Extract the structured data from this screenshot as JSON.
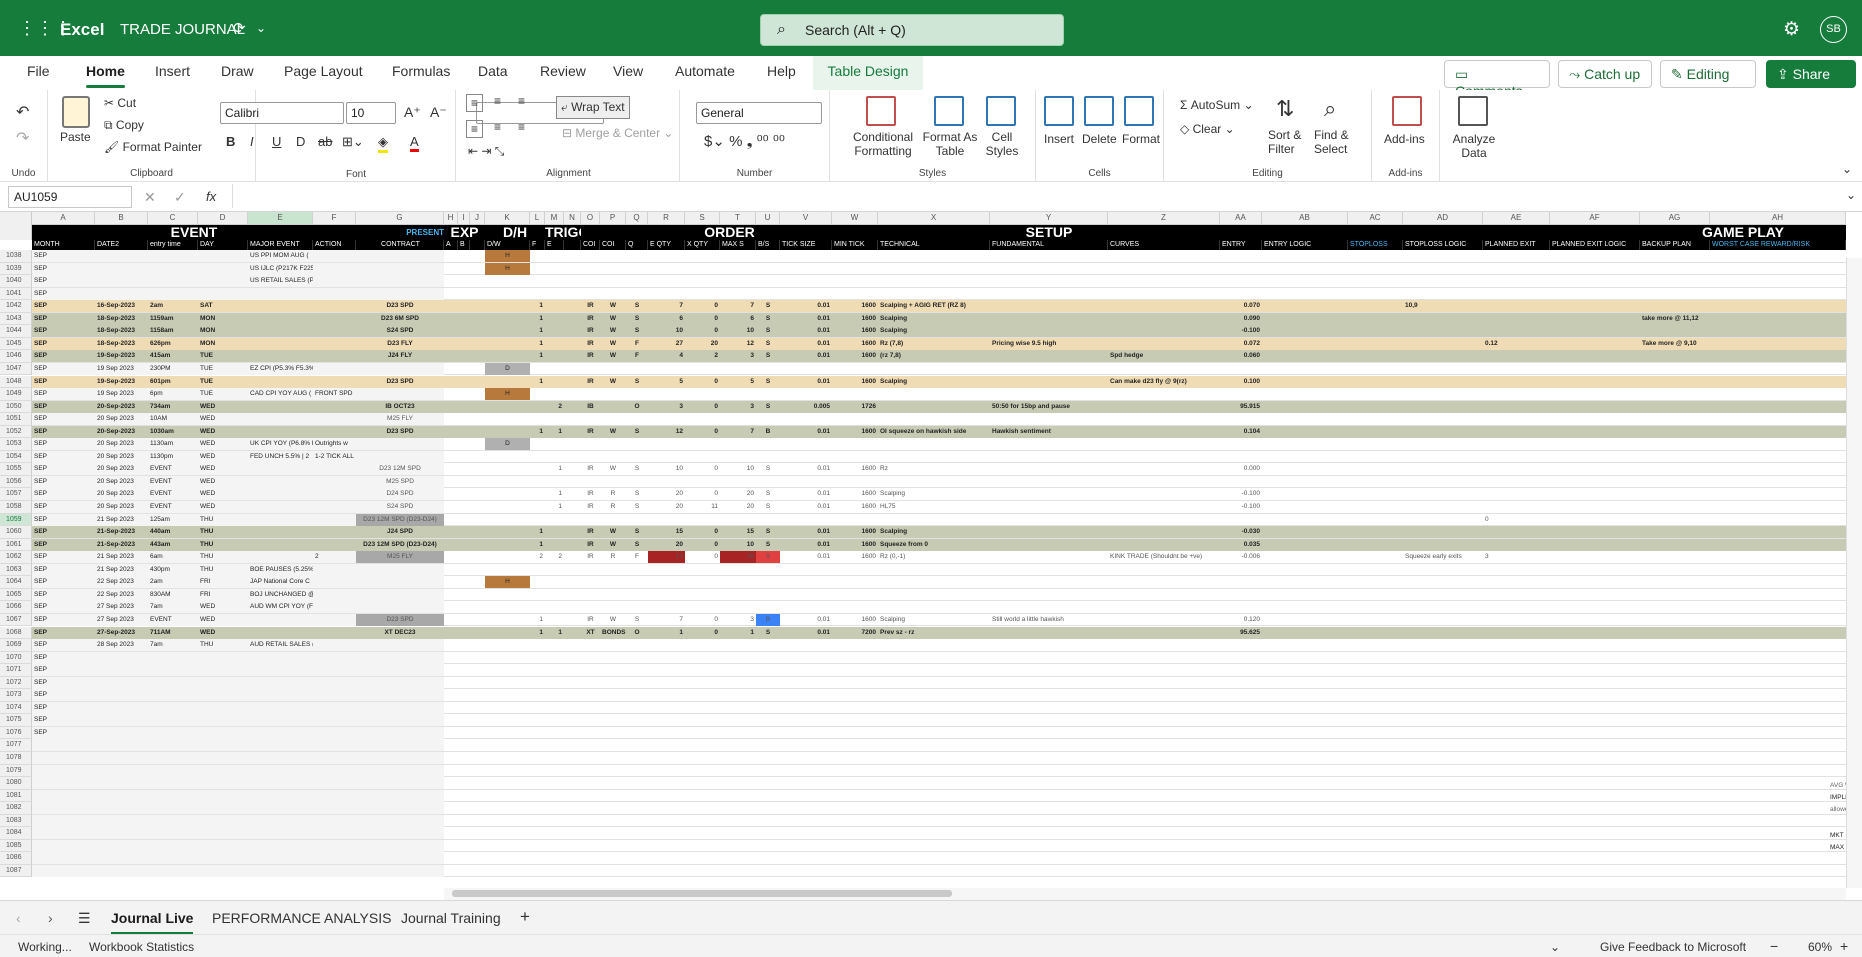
{
  "titlebar": {
    "app": "Excel",
    "doc": "TRADE JOURNAL",
    "search": "Search (Alt + Q)",
    "avatar": "SB"
  },
  "menu": [
    "File",
    "Home",
    "Insert",
    "Draw",
    "Page Layout",
    "Formulas",
    "Data",
    "Review",
    "View",
    "Automate",
    "Help",
    "Table Design"
  ],
  "actions": {
    "comments": "Comments",
    "catchup": "Catch up",
    "editing": "Editing",
    "share": "Share"
  },
  "ribbon": {
    "undo": "Undo",
    "paste": "Paste",
    "cut": "Cut",
    "copy": "Copy",
    "format_painter": "Format Painter",
    "clipboard": "Clipboard",
    "font_name": "Calibri",
    "font_size": "10",
    "font": "Font",
    "wrap_text": "Wrap Text",
    "merge": "Merge & Center",
    "alignment": "Alignment",
    "number_format": "General",
    "number": "Number",
    "cond_format": "Conditional Formatting",
    "format_table": "Format As Table",
    "cell_styles": "Cell Styles",
    "styles": "Styles",
    "insert": "Insert",
    "delete": "Delete",
    "format": "Format",
    "cells": "Cells",
    "autosum": "AutoSum",
    "clear": "Clear",
    "sort_filter": "Sort & Filter",
    "find_select": "Find & Select",
    "editing": "Editing",
    "addins": "Add-ins",
    "addins_grp": "Add-ins",
    "analyze": "Analyze Data"
  },
  "formula": {
    "namebox": "AU1059",
    "fx": "fx"
  },
  "bands": [
    "EVENT",
    "PRESENT",
    "EXP",
    "D/H",
    "TRIGGER",
    "ORDER",
    "SETUP",
    "GAME PLAY"
  ],
  "headers": [
    "MONTH",
    "DATE2",
    "entry time",
    "DAY",
    "MAJOR EVENT",
    "ACTION",
    "CONTRACT",
    "A",
    "B",
    "D/W",
    "F",
    "E",
    "COI",
    "COI",
    "Q",
    "E QTY",
    "X QTY",
    "MAX S",
    "B/S",
    "TICK SIZE",
    "MIN TICK",
    "TECHNICAL",
    "FUNDAMENTAL",
    "CURVES",
    "ENTRY",
    "ENTRY LOGIC",
    "STOPLOSS",
    "STOPLOSS LOGIC",
    "PLANNED EXIT",
    "PLANNED EXIT LOGIC",
    "BACKUP PLAN",
    "WORST CASE REWARD/RISK",
    "WORS"
  ],
  "colletters": [
    "A",
    "B",
    "C",
    "D",
    "E",
    "F",
    "G",
    "H",
    "I",
    "J",
    "K",
    "L",
    "M",
    "N",
    "O",
    "P",
    "Q",
    "R",
    "S",
    "T",
    "U",
    "V",
    "W",
    "X",
    "Y",
    "Z",
    "AA",
    "AB",
    "AC",
    "AD",
    "AE",
    "AF",
    "AG",
    "AH"
  ],
  "rows": [
    {
      "n": "1038",
      "m": "SEP",
      "ev": "US PPI MOM AUG (",
      "dh": "H"
    },
    {
      "n": "1039",
      "m": "SEP",
      "ev": "US IJLC (P217K F225",
      "dh": "H"
    },
    {
      "n": "1040",
      "m": "SEP",
      "ev": "US RETAIL SALES (P("
    },
    {
      "n": "1041",
      "m": "SEP"
    },
    {
      "n": "1042",
      "m": "SEP",
      "d": "16-Sep-2023",
      "t": "2am",
      "day": "SAT",
      "c": "D23 SPD",
      "l": "1",
      "o": "IR",
      "p": "W",
      "q": "S",
      "r": "7",
      "s": "0",
      "tt": "7",
      "u": "S",
      "v": "0.01",
      "w": "1600",
      "x": "Scalping + AGIG RET (RZ 8)",
      "aa": "0.070",
      "ad": "10,9",
      "bg": "#f0dcb4"
    },
    {
      "n": "1043",
      "m": "SEP",
      "d": "18-Sep-2023",
      "t": "1159am",
      "day": "MON",
      "c": "D23 6M SPD",
      "l": "1",
      "o": "IR",
      "p": "W",
      "q": "S",
      "r": "6",
      "s": "0",
      "tt": "6",
      "u": "S",
      "v": "0.01",
      "w": "1600",
      "x": "Scalping",
      "aa": "0.090",
      "ag": "take more @ 11,12",
      "bg": "#c8cbb4"
    },
    {
      "n": "1044",
      "m": "SEP",
      "d": "18-Sep-2023",
      "t": "1158am",
      "day": "MON",
      "c": "S24 SPD",
      "l": "1",
      "o": "IR",
      "p": "W",
      "q": "S",
      "r": "10",
      "s": "0",
      "tt": "10",
      "u": "S",
      "v": "0.01",
      "w": "1600",
      "x": "Scalping",
      "aa": "-0.100",
      "bg": "#c8cbb4"
    },
    {
      "n": "1045",
      "m": "SEP",
      "d": "18-Sep-2023",
      "t": "626pm",
      "day": "MON",
      "c": "D23 FLY",
      "l": "1",
      "o": "IR",
      "p": "W",
      "q": "F",
      "r": "27",
      "s": "20",
      "tt": "12",
      "u": "S",
      "v": "0.01",
      "w": "1600",
      "x": "Rz (7,8)",
      "y": "Pricing wise 9.5 high",
      "aa": "0.072",
      "ae": "0.12",
      "ag": "Take more @ 9,10",
      "bg": "#f0dcb4"
    },
    {
      "n": "1046",
      "m": "SEP",
      "d": "19-Sep-2023",
      "t": "415am",
      "day": "TUE",
      "c": "J24 FLY",
      "l": "1",
      "o": "IR",
      "p": "W",
      "q": "F",
      "r": "4",
      "s": "2",
      "tt": "3",
      "u": "S",
      "v": "0.01",
      "w": "1600",
      "x": "(rz 7,8)",
      "z": "Spd hedge",
      "aa": "0.060",
      "bg": "#c8cbb4"
    },
    {
      "n": "1047",
      "m": "SEP",
      "d": "19 Sep 2023",
      "t": "230PM",
      "day": "TUE",
      "ev": "EZ CPI (P5.3% F5.3%",
      "dh": "D"
    },
    {
      "n": "1048",
      "m": "SEP",
      "d": "19-Sep-2023",
      "t": "601pm",
      "day": "TUE",
      "c": "D23 SPD",
      "l": "1",
      "o": "IR",
      "p": "W",
      "q": "S",
      "r": "5",
      "s": "0",
      "tt": "5",
      "u": "S",
      "v": "0.01",
      "w": "1600",
      "x": "Scalping",
      "z": "Can make d23 fly @ 9(rz)",
      "aa": "0.100",
      "bg": "#f0dcb4"
    },
    {
      "n": "1049",
      "m": "SEP",
      "d": "19 Sep 2023",
      "t": "6pm",
      "day": "TUE",
      "ev": "CAD CPI YOY AUG (",
      "ac": "FRONT SPD",
      "dh": "H"
    },
    {
      "n": "1050",
      "m": "SEP",
      "d": "20-Sep-2023",
      "t": "734am",
      "day": "WED",
      "c": "IB OCT23",
      "l2": "2",
      "o": "IB",
      "q": "O",
      "r": "3",
      "s": "0",
      "tt": "3",
      "u": "S",
      "v": "0.005",
      "w": "1726",
      "y": "50:50 for 15bp and pause",
      "aa": "95.915",
      "bg": "#c8cbb4"
    },
    {
      "n": "1051",
      "m": "SEP",
      "d": "20 Sep 2023",
      "t": "10AM",
      "day": "WED",
      "c": "M25 FLY"
    },
    {
      "n": "1052",
      "m": "SEP",
      "d": "20-Sep-2023",
      "t": "1030am",
      "day": "WED",
      "c": "D23 SPD",
      "l": "1",
      "l2": "1",
      "o": "IR",
      "p": "W",
      "q": "S",
      "r": "12",
      "s": "0",
      "tt": "7",
      "u": "B",
      "v": "0.01",
      "w": "1600",
      "x": "OI squeeze on hawkish side",
      "y": "Hawkish sentiment",
      "aa": "0.104",
      "bg": "#c8cbb4"
    },
    {
      "n": "1053",
      "m": "SEP",
      "d": "20 Sep 2023",
      "t": "1130am",
      "day": "WED",
      "ev": "UK CPI YOY (P6.8% F",
      "ac": "Outrights w",
      "dh": "D"
    },
    {
      "n": "1054",
      "m": "SEP",
      "d": "20 Sep 2023",
      "t": "1130pm",
      "day": "WED",
      "ev": "FED UNCH 5.5% | 2",
      "ac": "1-2 TICK ALL"
    },
    {
      "n": "1055",
      "m": "SEP",
      "d": "20 Sep 2023",
      "t": "EVENT",
      "day": "WED",
      "c": "D23 12M SPD",
      "l2": "1",
      "o": "IR",
      "p": "W",
      "q": "S",
      "r": "10",
      "s": "0",
      "tt": "10",
      "u": "S",
      "v": "0.01",
      "w": "1600",
      "x": "Rz",
      "aa": "0.000"
    },
    {
      "n": "1056",
      "m": "SEP",
      "d": "20 Sep 2023",
      "t": "EVENT",
      "day": "WED",
      "c": "M25 SPD"
    },
    {
      "n": "1057",
      "m": "SEP",
      "d": "20 Sep 2023",
      "t": "EVENT",
      "day": "WED",
      "c": "D24 SPD",
      "l2": "1",
      "o": "IR",
      "p": "R",
      "q": "S",
      "r": "20",
      "s": "0",
      "tt": "20",
      "u": "S",
      "v": "0.01",
      "w": "1600",
      "x": "Scalping",
      "aa": "-0.100"
    },
    {
      "n": "1058",
      "m": "SEP",
      "d": "20 Sep 2023",
      "t": "EVENT",
      "day": "WED",
      "c": "S24 SPD",
      "l2": "1",
      "o": "IR",
      "p": "R",
      "q": "S",
      "r": "20",
      "s": "11",
      "tt": "20",
      "u": "S",
      "v": "0.01",
      "w": "1600",
      "x": "HL75",
      "aa": "-0.100"
    },
    {
      "n": "1059",
      "m": "SEP",
      "d": "21 Sep 2023",
      "t": "125am",
      "day": "THU",
      "c": "D23 12M SPD (D23-D24)",
      "ae": "0"
    },
    {
      "n": "1060",
      "m": "SEP",
      "d": "21-Sep-2023",
      "t": "440am",
      "day": "THU",
      "c": "J24 SPD",
      "l": "1",
      "o": "IR",
      "p": "W",
      "q": "S",
      "r": "15",
      "s": "0",
      "tt": "15",
      "u": "S",
      "v": "0.01",
      "w": "1600",
      "x": "Scalping",
      "aa": "-0.030",
      "bg": "#c8cbb4"
    },
    {
      "n": "1061",
      "m": "SEP",
      "d": "21-Sep-2023",
      "t": "443am",
      "day": "THU",
      "c": "D23 12M SPD (D23-D24)",
      "l": "1",
      "o": "IR",
      "p": "W",
      "q": "S",
      "r": "20",
      "s": "0",
      "tt": "10",
      "u": "S",
      "v": "0.01",
      "w": "1600",
      "x": "Squeeze from 0",
      "aa": "0.035",
      "bg": "#c8cbb4"
    },
    {
      "n": "1062",
      "m": "SEP",
      "d": "21 Sep 2023",
      "t": "6am",
      "day": "THU",
      "c": "M25 FLY",
      "l": "2",
      "l2": "2",
      "o": "IR",
      "p": "R",
      "q": "F",
      "r": "13",
      "s": "0",
      "tt": "26",
      "u": "S",
      "v": "0.01",
      "w": "1600",
      "x": "Rz (0,-1)",
      "z": "KINK TRADE (Shouldnt be +ve)",
      "aa": "-0.006",
      "ac": "2",
      "ad": "Squeeze early exits",
      "ae": "3",
      "red": "1"
    },
    {
      "n": "1063",
      "m": "SEP",
      "d": "21 Sep 2023",
      "t": "430pm",
      "day": "THU",
      "ev": "BOE PAUSES (5.25%"
    },
    {
      "n": "1064",
      "m": "SEP",
      "d": "22 Sep 2023",
      "t": "2am",
      "day": "FRI",
      "ev": "JAP National Core C",
      "dh": "H"
    },
    {
      "n": "1065",
      "m": "SEP",
      "d": "22 Sep 2023",
      "t": "830AM",
      "day": "FRI",
      "ev": "BOJ UNCHANGED @"
    },
    {
      "n": "1066",
      "m": "SEP",
      "d": "27 Sep 2023",
      "t": "7am",
      "day": "WED",
      "ev": "AUD WM CPI YOY (F"
    },
    {
      "n": "1067",
      "m": "SEP",
      "d": "27 Sep 2023",
      "t": "EVENT",
      "day": "WED",
      "c": "D23 SPD",
      "l": "1",
      "o": "IR",
      "p": "W",
      "q": "S",
      "r": "7",
      "s": "0",
      "tt": "3",
      "u": "B",
      "v": "0.01",
      "w": "1600",
      "x": "Scalping",
      "y": "Still world a little hawkish",
      "aa": "0.120",
      "blue": "1"
    },
    {
      "n": "1068",
      "m": "SEP",
      "d": "27-Sep-2023",
      "t": "711AM",
      "day": "WED",
      "c": "XT DEC23",
      "l": "1",
      "l2": "1",
      "o": "XT",
      "p": "BONDS",
      "q": "O",
      "r": "1",
      "s": "0",
      "tt": "1",
      "u": "S",
      "v": "0.01",
      "w": "7200",
      "x": "Prev sz - rz",
      "aa": "95.625",
      "bg": "#c8cbb4"
    },
    {
      "n": "1069",
      "m": "SEP",
      "d": "28 Sep 2023",
      "t": "7am",
      "day": "THU",
      "ev": "AUD RETAIL SALES ("
    },
    {
      "n": "1070",
      "m": "SEP"
    },
    {
      "n": "1071",
      "m": "SEP"
    },
    {
      "n": "1072",
      "m": "SEP"
    },
    {
      "n": "1073",
      "m": "SEP"
    },
    {
      "n": "1074",
      "m": "SEP"
    },
    {
      "n": "1075",
      "m": "SEP"
    },
    {
      "n": "1076",
      "m": "SEP"
    },
    {
      "n": "1077"
    },
    {
      "n": "1078"
    },
    {
      "n": "1079"
    },
    {
      "n": "1080"
    },
    {
      "n": "1081"
    },
    {
      "n": "1082"
    },
    {
      "n": "1083"
    },
    {
      "n": "1084"
    },
    {
      "n": "1085"
    },
    {
      "n": "1086"
    },
    {
      "n": "1087"
    }
  ],
  "side_labels": {
    "avg": "AVG W",
    "impl": "IMPLIE",
    "allowed": "allowe",
    "mkt": "MKT S",
    "max": "MAX T"
  },
  "tabs": [
    "Journal Live",
    "PERFORMANCE ANALYSIS",
    "Journal Training"
  ],
  "status": {
    "left": "Working...",
    "stats": "Workbook Statistics",
    "feedback": "Give Feedback to Microsoft",
    "zoom": "60%"
  }
}
